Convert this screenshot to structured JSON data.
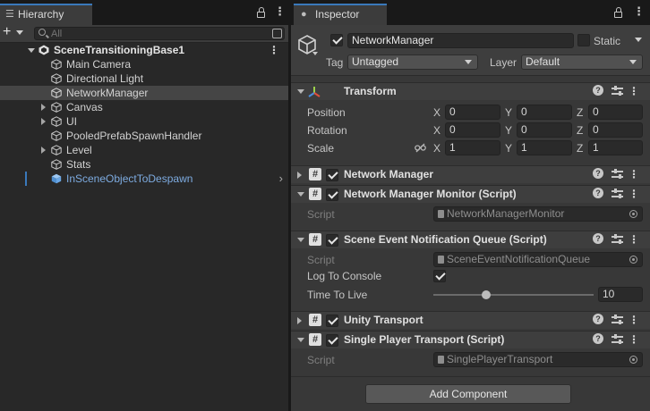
{
  "hierarchy": {
    "tab_label": "Hierarchy",
    "search_placeholder": "All",
    "scene_name": "SceneTransitioningBase1",
    "items": [
      {
        "label": "Main Camera",
        "indent": 1,
        "expandable": false,
        "selected": false,
        "prefab": false
      },
      {
        "label": "Directional Light",
        "indent": 1,
        "expandable": false,
        "selected": false,
        "prefab": false
      },
      {
        "label": "NetworkManager",
        "indent": 1,
        "expandable": false,
        "selected": true,
        "prefab": false
      },
      {
        "label": "Canvas",
        "indent": 1,
        "expandable": true,
        "selected": false,
        "prefab": false
      },
      {
        "label": "UI",
        "indent": 1,
        "expandable": true,
        "selected": false,
        "prefab": false
      },
      {
        "label": "PooledPrefabSpawnHandler",
        "indent": 1,
        "expandable": false,
        "selected": false,
        "prefab": false
      },
      {
        "label": "Level",
        "indent": 1,
        "expandable": true,
        "selected": false,
        "prefab": false
      },
      {
        "label": "Stats",
        "indent": 1,
        "expandable": false,
        "selected": false,
        "prefab": false
      },
      {
        "label": "InSceneObjectToDespawn",
        "indent": 1,
        "expandable": false,
        "selected": false,
        "prefab": true
      }
    ]
  },
  "inspector": {
    "tab_label": "Inspector",
    "object_name": "NetworkManager",
    "active": true,
    "static_label": "Static",
    "static_checked": false,
    "tag_label": "Tag",
    "tag_value": "Untagged",
    "layer_label": "Layer",
    "layer_value": "Default",
    "transform": {
      "title": "Transform",
      "rows": [
        {
          "label": "Position",
          "x": "0",
          "y": "0",
          "z": "0"
        },
        {
          "label": "Rotation",
          "x": "0",
          "y": "0",
          "z": "0"
        },
        {
          "label": "Scale",
          "x": "1",
          "y": "1",
          "z": "1"
        }
      ],
      "axis_x": "X",
      "axis_y": "Y",
      "axis_z": "Z"
    },
    "network_manager": {
      "title": "Network Manager",
      "enabled": true
    },
    "network_manager_monitor": {
      "title": "Network Manager Monitor (Script)",
      "enabled": true,
      "script_label": "Script",
      "script_value": "NetworkManagerMonitor"
    },
    "scene_event_queue": {
      "title": "Scene Event Notification Queue (Script)",
      "enabled": true,
      "script_label": "Script",
      "script_value": "SceneEventNotificationQueue",
      "log_label": "Log To Console",
      "log_checked": true,
      "ttl_label": "Time To Live",
      "ttl_value": "10",
      "ttl_fraction": 0.33
    },
    "unity_transport": {
      "title": "Unity Transport",
      "enabled": true
    },
    "single_player_transport": {
      "title": "Single Player Transport (Script)",
      "enabled": true,
      "script_label": "Script",
      "script_value": "SinglePlayerTransport"
    },
    "add_component_label": "Add Component"
  },
  "colors": {
    "accent": "#3a79bb",
    "prefab_text": "#7dabe0",
    "selected_row": "#454545"
  }
}
